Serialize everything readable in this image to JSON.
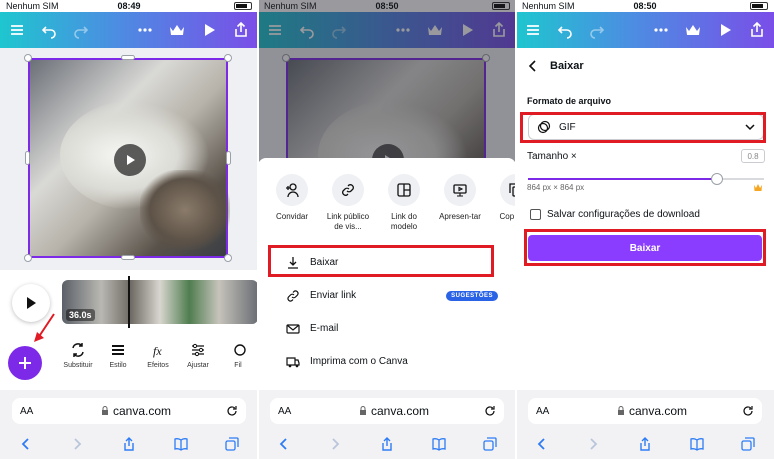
{
  "status": {
    "carrier": "Nenhum SIM",
    "panel1_time": "08:49",
    "panel2_time": "08:50",
    "panel3_time": "08:50"
  },
  "editor": {
    "clip_duration": "36.0s",
    "tools": [
      "Substituir",
      "Estilo",
      "Efeitos",
      "Ajustar",
      "Fil"
    ]
  },
  "share_sheet": {
    "actions": [
      "Convidar",
      "Link públic­o de vis...",
      "Link do modelo",
      "Apresen-tar",
      "Cop para"
    ],
    "menu": [
      {
        "label": "Baixar"
      },
      {
        "label": "Enviar link",
        "badge": "SUGESTÕES"
      },
      {
        "label": "E-mail"
      },
      {
        "label": "Imprima com o Canva"
      }
    ]
  },
  "download": {
    "title": "Baixar",
    "format_label": "Formato de arquivo",
    "format_value": "GIF",
    "size_label": "Tamanho ×",
    "size_value": "0.8",
    "slider_fraction": 0.8,
    "dimensions": "864 px × 864 px",
    "save_settings_label": "Salvar configurações de download",
    "download_button": "Baixar"
  },
  "browser": {
    "aa": "AA",
    "domain": "canva.com"
  },
  "colors": {
    "accent": "#7d2ae8",
    "highlight": "#e01b24",
    "badge": "#2b63e6"
  }
}
